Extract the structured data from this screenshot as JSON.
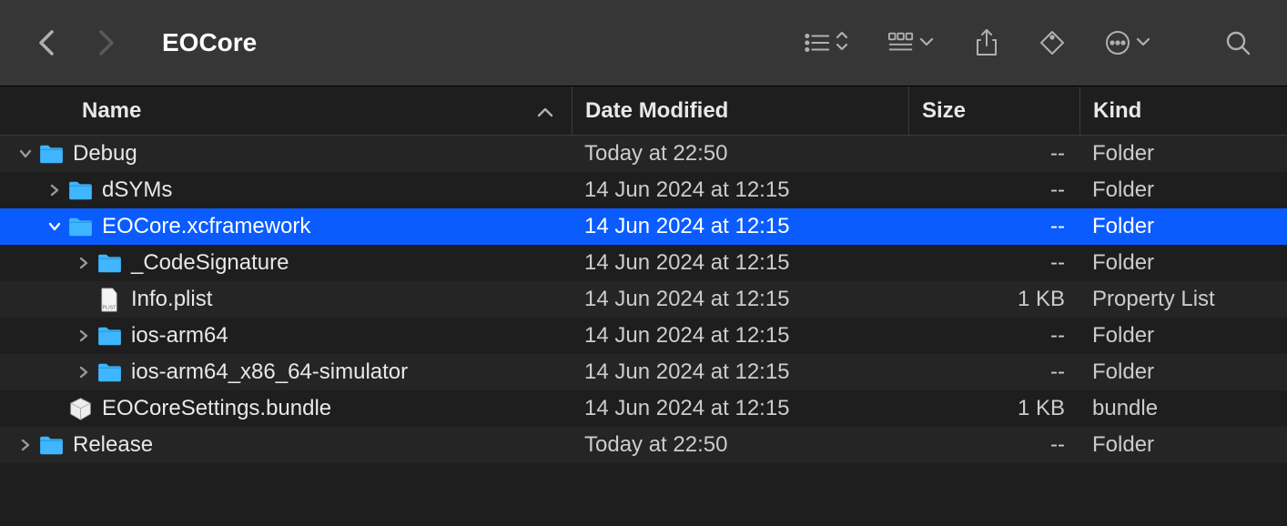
{
  "toolbar": {
    "title": "EOCore"
  },
  "columns": {
    "name": "Name",
    "date": "Date Modified",
    "size": "Size",
    "kind": "Kind"
  },
  "rows": [
    {
      "indent": 0,
      "disclosure": "down",
      "icon": "folder",
      "name": "Debug",
      "date": "Today at 22:50",
      "size": "--",
      "kind": "Folder",
      "selected": false
    },
    {
      "indent": 1,
      "disclosure": "right",
      "icon": "folder",
      "name": "dSYMs",
      "date": "14 Jun 2024 at 12:15",
      "size": "--",
      "kind": "Folder",
      "selected": false
    },
    {
      "indent": 1,
      "disclosure": "down",
      "icon": "folder",
      "name": "EOCore.xcframework",
      "date": "14 Jun 2024 at 12:15",
      "size": "--",
      "kind": "Folder",
      "selected": true
    },
    {
      "indent": 2,
      "disclosure": "right",
      "icon": "folder",
      "name": "_CodeSignature",
      "date": "14 Jun 2024 at 12:15",
      "size": "--",
      "kind": "Folder",
      "selected": false
    },
    {
      "indent": 2,
      "disclosure": "none",
      "icon": "plist",
      "name": "Info.plist",
      "date": "14 Jun 2024 at 12:15",
      "size": "1 KB",
      "kind": "Property List",
      "selected": false
    },
    {
      "indent": 2,
      "disclosure": "right",
      "icon": "folder",
      "name": "ios-arm64",
      "date": "14 Jun 2024 at 12:15",
      "size": "--",
      "kind": "Folder",
      "selected": false
    },
    {
      "indent": 2,
      "disclosure": "right",
      "icon": "folder",
      "name": "ios-arm64_x86_64-simulator",
      "date": "14 Jun 2024 at 12:15",
      "size": "--",
      "kind": "Folder",
      "selected": false
    },
    {
      "indent": 1,
      "disclosure": "none",
      "icon": "bundle",
      "name": "EOCoreSettings.bundle",
      "date": "14 Jun 2024 at 12:15",
      "size": "1 KB",
      "kind": "bundle",
      "selected": false
    },
    {
      "indent": 0,
      "disclosure": "right",
      "icon": "folder",
      "name": "Release",
      "date": "Today at 22:50",
      "size": "--",
      "kind": "Folder",
      "selected": false
    }
  ]
}
